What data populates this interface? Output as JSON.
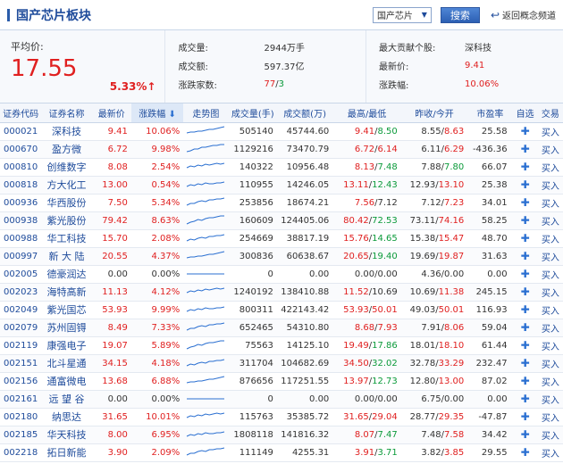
{
  "header": {
    "title": "国产芯片板块",
    "select_value": "国产芯片",
    "search_label": "搜索",
    "back_label": "返回概念频道"
  },
  "summary": {
    "avg_label": "平均价:",
    "avg_value": "17.55",
    "avg_change": "5.33%↑",
    "volume_label": "成交量:",
    "volume_value": "2944万手",
    "amount_label": "成交额:",
    "amount_value": "597.37亿",
    "updown_label": "涨跌家数:",
    "up_count": "77",
    "down_count": "3",
    "top_label": "最大贡献个股:",
    "top_value": "深科技",
    "last_label": "最新价:",
    "last_value": "9.41",
    "chg_label": "涨跌幅:",
    "chg_value": "10.06%"
  },
  "table": {
    "headers": [
      "证券代码",
      "证券名称",
      "最新价",
      "涨跌幅",
      "走势图",
      "成交量(手)",
      "成交额(万)",
      "最高/最低",
      "昨收/今开",
      "市盈率",
      "自选",
      "交易"
    ],
    "sort_arrow": "⬇",
    "buy_label": "买入",
    "rows": [
      {
        "code": "000021",
        "name": "深科技",
        "price": "9.41",
        "chg": "10.06%",
        "vol": "505140",
        "amt": "45744.60",
        "high": "9.41",
        "low": "8.50",
        "prev": "8.55",
        "open": "8.63",
        "pe": "25.58",
        "dir": "up",
        "open_dir": "up",
        "low_dir": "down"
      },
      {
        "code": "000670",
        "name": "盈方微",
        "price": "6.72",
        "chg": "9.98%",
        "vol": "1129216",
        "amt": "73470.79",
        "high": "6.72",
        "low": "6.14",
        "prev": "6.11",
        "open": "6.29",
        "pe": "-436.36",
        "dir": "up",
        "open_dir": "up",
        "low_dir": "up"
      },
      {
        "code": "000810",
        "name": "创维数字",
        "price": "8.08",
        "chg": "2.54%",
        "vol": "140322",
        "amt": "10956.48",
        "high": "8.13",
        "low": "7.48",
        "prev": "7.88",
        "open": "7.80",
        "pe": "66.07",
        "dir": "up",
        "open_dir": "down",
        "low_dir": "down"
      },
      {
        "code": "000818",
        "name": "方大化工",
        "price": "13.00",
        "chg": "0.54%",
        "vol": "110955",
        "amt": "14246.05",
        "high": "13.11",
        "low": "12.43",
        "prev": "12.93",
        "open": "13.10",
        "pe": "25.38",
        "dir": "up",
        "open_dir": "up",
        "low_dir": "down"
      },
      {
        "code": "000936",
        "name": "华西股份",
        "price": "7.50",
        "chg": "5.34%",
        "vol": "253856",
        "amt": "18674.21",
        "high": "7.56",
        "low": "7.12",
        "prev": "7.12",
        "open": "7.23",
        "pe": "34.01",
        "dir": "up",
        "open_dir": "up",
        "low_dir": "flat"
      },
      {
        "code": "000938",
        "name": "紫光股份",
        "price": "79.42",
        "chg": "8.63%",
        "vol": "160609",
        "amt": "124405.06",
        "high": "80.42",
        "low": "72.53",
        "prev": "73.11",
        "open": "74.16",
        "pe": "58.25",
        "dir": "up",
        "open_dir": "up",
        "low_dir": "down"
      },
      {
        "code": "000988",
        "name": "华工科技",
        "price": "15.70",
        "chg": "2.08%",
        "vol": "254669",
        "amt": "38817.19",
        "high": "15.76",
        "low": "14.65",
        "prev": "15.38",
        "open": "15.47",
        "pe": "48.70",
        "dir": "up",
        "open_dir": "up",
        "low_dir": "down"
      },
      {
        "code": "000997",
        "name": "新 大 陆",
        "price": "20.55",
        "chg": "4.37%",
        "vol": "300836",
        "amt": "60638.67",
        "high": "20.65",
        "low": "19.40",
        "prev": "19.69",
        "open": "19.87",
        "pe": "31.63",
        "dir": "up",
        "open_dir": "up",
        "low_dir": "down"
      },
      {
        "code": "002005",
        "name": "德豪润达",
        "price": "0.00",
        "chg": "0.00%",
        "vol": "0",
        "amt": "0.00",
        "high": "0.00",
        "low": "0.00",
        "prev": "4.36",
        "open": "0.00",
        "pe": "0.00",
        "dir": "flat",
        "open_dir": "flat",
        "low_dir": "flat"
      },
      {
        "code": "002023",
        "name": "海特高新",
        "price": "11.13",
        "chg": "4.12%",
        "vol": "1240192",
        "amt": "138410.88",
        "high": "11.52",
        "low": "10.69",
        "prev": "10.69",
        "open": "11.38",
        "pe": "245.15",
        "dir": "up",
        "open_dir": "up",
        "low_dir": "flat"
      },
      {
        "code": "002049",
        "name": "紫光国芯",
        "price": "53.93",
        "chg": "9.99%",
        "vol": "800311",
        "amt": "422143.42",
        "high": "53.93",
        "low": "50.01",
        "prev": "49.03",
        "open": "50.01",
        "pe": "116.93",
        "dir": "up",
        "open_dir": "up",
        "low_dir": "up"
      },
      {
        "code": "002079",
        "name": "苏州固锝",
        "price": "8.49",
        "chg": "7.33%",
        "vol": "652465",
        "amt": "54310.80",
        "high": "8.68",
        "low": "7.93",
        "prev": "7.91",
        "open": "8.06",
        "pe": "59.04",
        "dir": "up",
        "open_dir": "up",
        "low_dir": "up"
      },
      {
        "code": "002119",
        "name": "康强电子",
        "price": "19.07",
        "chg": "5.89%",
        "vol": "75563",
        "amt": "14125.10",
        "high": "19.49",
        "low": "17.86",
        "prev": "18.01",
        "open": "18.10",
        "pe": "61.44",
        "dir": "up",
        "open_dir": "up",
        "low_dir": "down"
      },
      {
        "code": "002151",
        "name": "北斗星通",
        "price": "34.15",
        "chg": "4.18%",
        "vol": "311704",
        "amt": "104682.69",
        "high": "34.50",
        "low": "32.02",
        "prev": "32.78",
        "open": "33.29",
        "pe": "232.47",
        "dir": "up",
        "open_dir": "up",
        "low_dir": "down"
      },
      {
        "code": "002156",
        "name": "通富微电",
        "price": "13.68",
        "chg": "6.88%",
        "vol": "876656",
        "amt": "117251.55",
        "high": "13.97",
        "low": "12.73",
        "prev": "12.80",
        "open": "13.00",
        "pe": "87.02",
        "dir": "up",
        "open_dir": "up",
        "low_dir": "down"
      },
      {
        "code": "002161",
        "name": "远 望 谷",
        "price": "0.00",
        "chg": "0.00%",
        "vol": "0",
        "amt": "0.00",
        "high": "0.00",
        "low": "0.00",
        "prev": "6.75",
        "open": "0.00",
        "pe": "0.00",
        "dir": "flat",
        "open_dir": "flat",
        "low_dir": "flat"
      },
      {
        "code": "002180",
        "name": "纳思达",
        "price": "31.65",
        "chg": "10.01%",
        "vol": "115763",
        "amt": "35385.72",
        "high": "31.65",
        "low": "29.04",
        "prev": "28.77",
        "open": "29.35",
        "pe": "-47.87",
        "dir": "up",
        "open_dir": "up",
        "low_dir": "up"
      },
      {
        "code": "002185",
        "name": "华天科技",
        "price": "8.00",
        "chg": "6.95%",
        "vol": "1808118",
        "amt": "141816.32",
        "high": "8.07",
        "low": "7.47",
        "prev": "7.48",
        "open": "7.58",
        "pe": "34.42",
        "dir": "up",
        "open_dir": "up",
        "low_dir": "down"
      },
      {
        "code": "002218",
        "name": "拓日新能",
        "price": "3.90",
        "chg": "2.09%",
        "vol": "111149",
        "amt": "4255.31",
        "high": "3.91",
        "low": "3.71",
        "prev": "3.82",
        "open": "3.85",
        "pe": "29.55",
        "dir": "up",
        "open_dir": "up",
        "low_dir": "down"
      }
    ]
  },
  "colors": {
    "up": "#e02020",
    "down": "#0b9a3a",
    "flat": "#333333",
    "accent": "#1e4b9b"
  }
}
